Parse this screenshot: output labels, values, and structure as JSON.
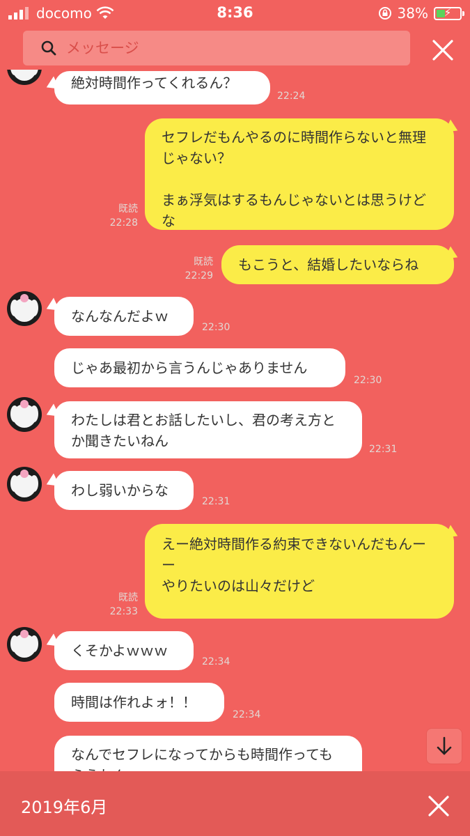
{
  "status_bar": {
    "carrier": "docomo",
    "time": "8:36",
    "battery_percent": "38%",
    "battery_level": 0.38
  },
  "search": {
    "placeholder": "メッセージ",
    "icon": "search-icon",
    "close_icon": "close-icon"
  },
  "messages": [
    {
      "side": "left",
      "avatar": true,
      "text": "絶対時間作ってくれるん？",
      "time": "22:24"
    },
    {
      "side": "right",
      "read": "既読",
      "time": "22:28",
      "text": "セフレだもんやるのに時間作らないと無理じゃない？\n\nまぁ浮気はするもんじゃないとは思うけどな"
    },
    {
      "side": "right",
      "read": "既読",
      "time": "22:29",
      "text": "もこうと、結婚したいならね"
    },
    {
      "side": "left",
      "avatar": true,
      "text": "なんなんだよｗ",
      "time": "22:30"
    },
    {
      "side": "left",
      "avatar": false,
      "text": "じゃあ最初から言うんじゃありません",
      "time": "22:30"
    },
    {
      "side": "left",
      "avatar": true,
      "text": "わたしは君とお話したいし、君の考え方とか聞きたいねん",
      "time": "22:31"
    },
    {
      "side": "left",
      "avatar": true,
      "text": "わし弱いからな",
      "time": "22:31"
    },
    {
      "side": "right",
      "read": "既読",
      "time": "22:33",
      "text": "えー絶対時間作る約束できないんだもんーー\nやりたいのは山々だけど"
    },
    {
      "side": "left",
      "avatar": true,
      "text": "くそかよｗｗｗ",
      "time": "22:34"
    },
    {
      "side": "left",
      "avatar": false,
      "text": "時間は作れよォ！！",
      "time": "22:34"
    },
    {
      "side": "left",
      "avatar": false,
      "text": "なんでセフレになってからも時間作ってもらうねん",
      "time": ""
    }
  ],
  "scroll_button_icon": "arrow-down-icon",
  "bottom_bar": {
    "date": "2019年6月",
    "close_icon": "close-icon"
  },
  "colors": {
    "background": "#f2615e",
    "my_bubble": "#fbec48",
    "their_bubble": "#ffffff"
  }
}
